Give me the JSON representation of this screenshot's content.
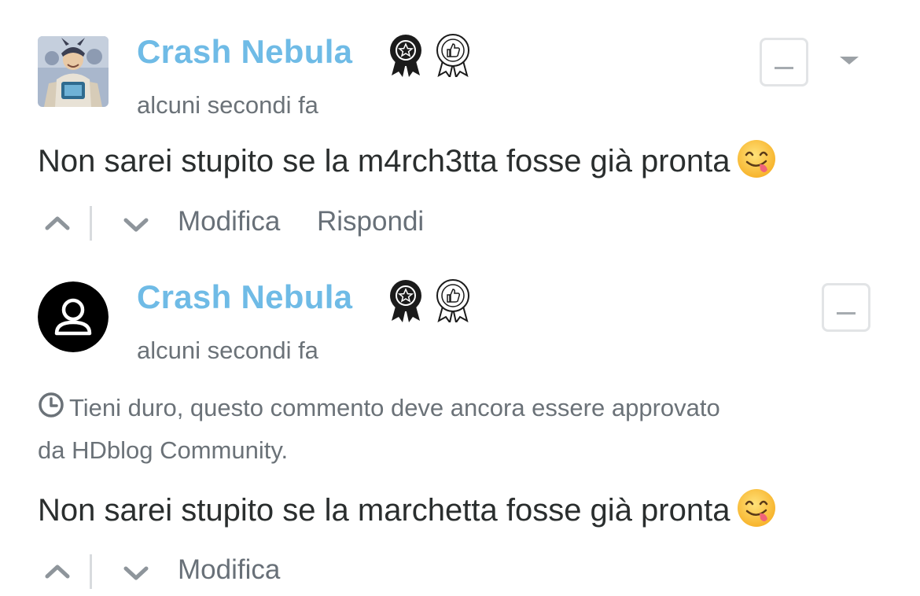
{
  "comments": [
    {
      "author": "Crash Nebula",
      "timestamp": "alcuni secondi fa",
      "text": "Non sarei stupito se la m4rch3tta fosse già pronta",
      "badges": [
        "star-ribbon-badge",
        "thumbs-up-ribbon-badge"
      ],
      "avatar": "custom-avatar",
      "actions": {
        "edit": "Modifica",
        "reply": "Rispondi"
      }
    },
    {
      "author": "Crash Nebula",
      "timestamp": "alcuni secondi fa",
      "pending_notice": "Tieni duro, questo commento deve ancora essere approvato da HDblog Community.",
      "text": "Non sarei stupito se la marchetta fosse già pronta",
      "badges": [
        "star-ribbon-badge",
        "thumbs-up-ribbon-badge"
      ],
      "avatar": "default-user-avatar",
      "actions": {
        "edit": "Modifica"
      }
    }
  ],
  "colors": {
    "author": "#6fbbe6",
    "meta": "#6b7278",
    "text": "#2a2e2e",
    "border": "#e2e4e6"
  }
}
